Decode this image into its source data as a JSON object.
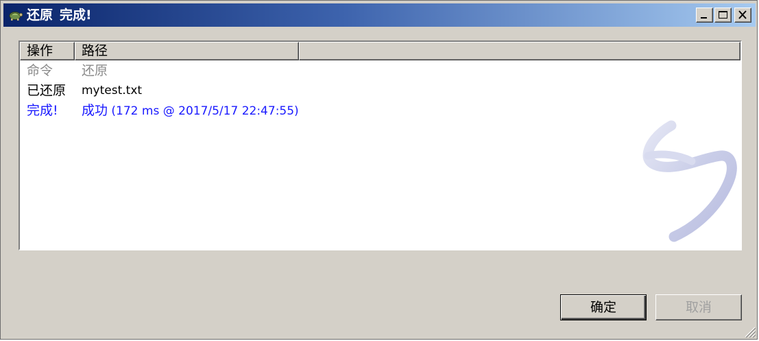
{
  "window": {
    "title_part1": "还原",
    "title_part2": "完成!"
  },
  "list": {
    "columns": [
      "操作",
      "路径",
      ""
    ],
    "rows": [
      {
        "action": "命令",
        "path": "还原",
        "style": "gray"
      },
      {
        "action": "已还原",
        "path": "mytest.txt",
        "style": "black"
      },
      {
        "action": "完成!",
        "path_prefix": "成功",
        "path": " (172 ms @ 2017/5/17 22:47:55)",
        "style": "blue"
      }
    ]
  },
  "buttons": {
    "ok": "确定",
    "cancel": "取消"
  },
  "icons": {
    "app": "tortoise-icon",
    "watermark": "revert-arrow-icon"
  },
  "colors": {
    "titlebar_start": "#0a246a",
    "titlebar_end": "#a6caf0",
    "gray_text": "#8a8a8a",
    "blue_text": "#1a1aff",
    "dialog_bg": "#d4d0c8"
  }
}
